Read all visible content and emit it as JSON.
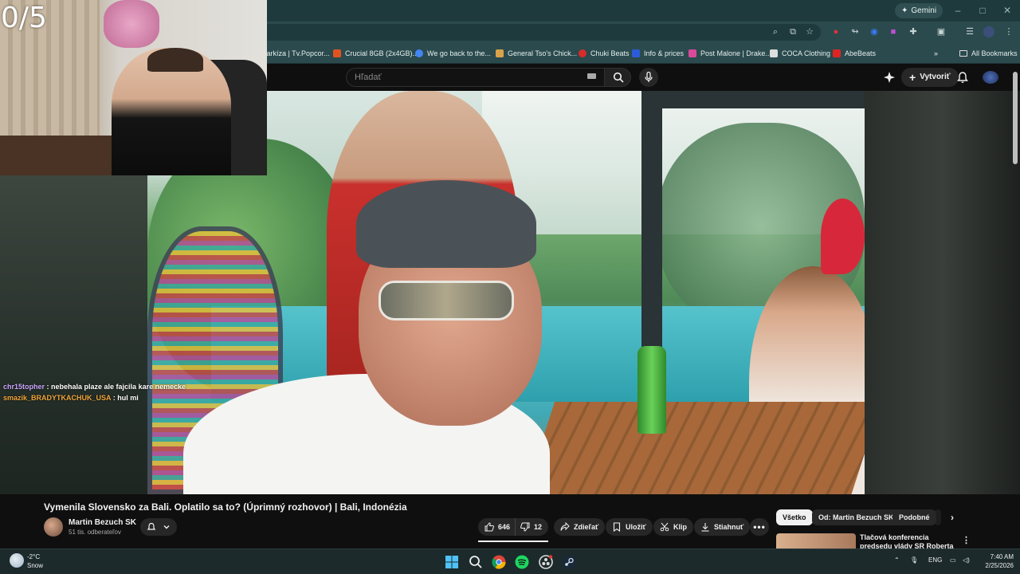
{
  "overlay": {
    "counter": "0/5"
  },
  "browser": {
    "gemini_label": "Gemini",
    "bookmarks": [
      {
        "label": "Markíza | Tv.Popcor...",
        "color": "#3a3a3a"
      },
      {
        "label": "Crucial 8GB (2x4GB)...",
        "color": "#e0531f"
      },
      {
        "label": "We go back to the...",
        "color": "#4285f4"
      },
      {
        "label": "General Tso's Chick...",
        "color": "#d9a24a"
      },
      {
        "label": "Chuki Beats",
        "color": "#d92b2b"
      },
      {
        "label": "Info & prices",
        "color": "#2c5bd8"
      },
      {
        "label": "Post Malone | Drake...",
        "color": "#d94a9a"
      },
      {
        "label": "COCA Clothing",
        "color": "#222222"
      },
      {
        "label": "AbeBeats",
        "color": "#e02424"
      }
    ],
    "all_bookmarks": "All Bookmarks"
  },
  "youtube": {
    "search_placeholder": "Hľadať",
    "create_label": "Vytvoriť",
    "video_title": "Vymenila Slovensko za Bali. Oplatilo sa to? (Úprimný rozhovor) | Bali, Indonézia",
    "channel_name": "Martin Bezuch SK",
    "subscribers": "51 tis. odberateľov",
    "likes": "646",
    "dislikes": "12",
    "share": "Zdieľať",
    "save": "Uložiť",
    "clip": "Klip",
    "download": "Stiahnuť",
    "chips": [
      "Všetko",
      "Od: Martin Bezuch SK",
      "Podobné"
    ],
    "recommended_title": "Tlačová konferencia predsedu vlády SR Roberta Fica po..."
  },
  "chat": [
    {
      "user": "chr15topher",
      "text": "nebehala plaze ale fajcila kare nemecke"
    },
    {
      "user": "smazik_BRADYTKACHUK_USA",
      "text": "hul mi"
    }
  ],
  "taskbar": {
    "temperature": "-2°C",
    "condition": "Snow",
    "language": "ENG",
    "time": "7:40 AM",
    "date": "2/25/2026"
  },
  "colors": {
    "browser_frame": "#1f3a3d",
    "youtube_bg": "#0f0f0f",
    "chat_user_1": "#c9a7ff",
    "chat_user_2": "#f0a63a"
  }
}
